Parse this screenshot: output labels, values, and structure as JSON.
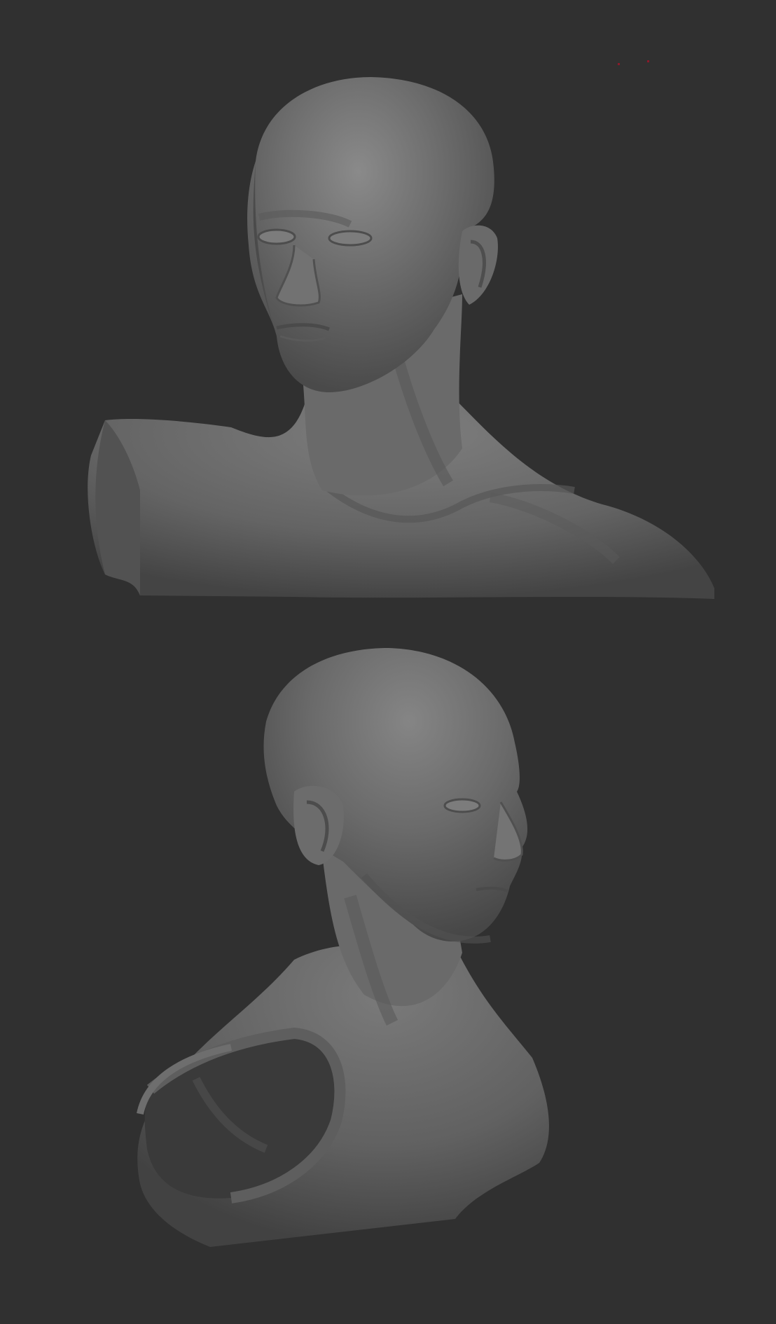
{
  "scene": {
    "background": "#303030",
    "material_color": "#6b6b6b",
    "views": [
      {
        "name": "front-three-quarter-view",
        "subject": "sculpt-bust"
      },
      {
        "name": "right-profile-view",
        "subject": "sculpt-bust"
      }
    ],
    "marker_color": "#8a1a2a"
  }
}
